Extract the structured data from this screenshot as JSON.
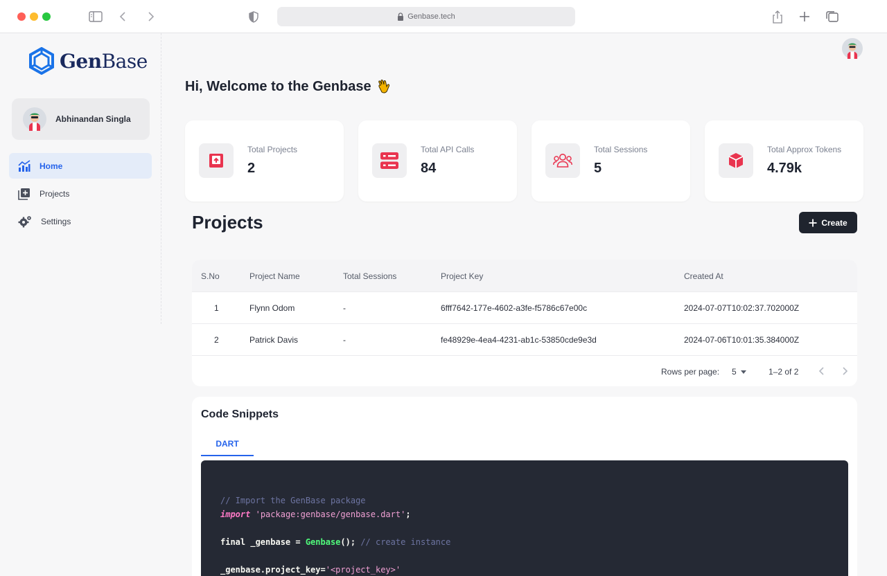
{
  "browser": {
    "url": "Genbase.tech",
    "traffic_colors": [
      "#ff5f57",
      "#febc2e",
      "#28c840"
    ]
  },
  "brand": {
    "name_bold": "Gen",
    "name_light": "Base",
    "color": "#1a73e8"
  },
  "user": {
    "name": "Abhinandan Singla"
  },
  "sidebar": {
    "items": [
      {
        "label": "Home",
        "icon": "chart-icon",
        "active": true
      },
      {
        "label": "Projects",
        "icon": "add-box-icon",
        "active": false
      },
      {
        "label": "Settings",
        "icon": "gear-icon",
        "active": false
      }
    ]
  },
  "header": {
    "welcome": "Hi, Welcome to the Genbase",
    "emoji": "👋"
  },
  "stats": [
    {
      "label": "Total Projects",
      "value": "2",
      "icon": "project-box-icon"
    },
    {
      "label": "Total API Calls",
      "value": "84",
      "icon": "server-icon"
    },
    {
      "label": "Total Sessions",
      "value": "5",
      "icon": "users-icon"
    },
    {
      "label": "Total Approx Tokens",
      "value": "4.79k",
      "icon": "cube-icon"
    }
  ],
  "accent_color": "#e9344f",
  "projects": {
    "title": "Projects",
    "create_label": "Create",
    "columns": [
      "S.No",
      "Project Name",
      "Total Sessions",
      "Project Key",
      "Created At"
    ],
    "rows": [
      {
        "sno": "1",
        "name": "Flynn Odom",
        "sessions": "-",
        "key": "6fff7642-177e-4602-a3fe-f5786c67e00c",
        "created": "2024-07-07T10:02:37.702000Z"
      },
      {
        "sno": "2",
        "name": "Patrick Davis",
        "sessions": "-",
        "key": "fe48929e-4ea4-4231-ab1c-53850cde9e3d",
        "created": "2024-07-06T10:01:35.384000Z"
      }
    ],
    "pagination": {
      "rows_label": "Rows per page:",
      "rows_value": "5",
      "range": "1–2 of 2"
    }
  },
  "code": {
    "title": "Code Snippets",
    "tab": "DART",
    "line1_comment": "// Import the GenBase package",
    "line2_kw": "import",
    "line2_str": "'package:genbase/genbase.dart'",
    "line2_end": ";",
    "line3_a": "final _genbase = ",
    "line3_class": "Genbase",
    "line3_b": "(); ",
    "line3_comment": "// create instance",
    "line4_a": "_genbase.project_key=",
    "line4_str": "'<project_key>'"
  }
}
